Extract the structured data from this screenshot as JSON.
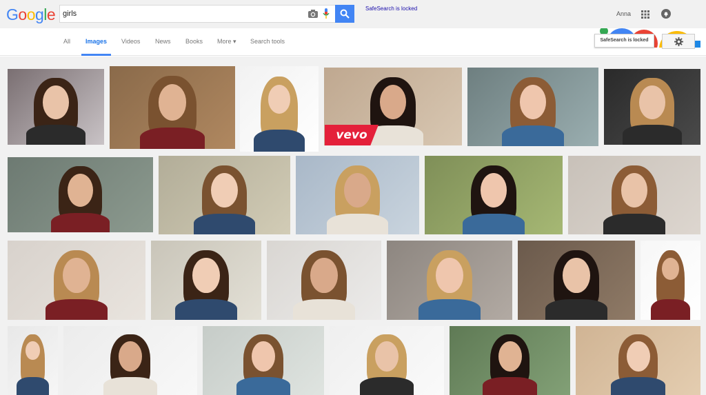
{
  "header": {
    "logo_letters": [
      {
        "ch": "G",
        "color": "#4285f4"
      },
      {
        "ch": "o",
        "color": "#ea4335"
      },
      {
        "ch": "o",
        "color": "#fbbc05"
      },
      {
        "ch": "g",
        "color": "#4285f4"
      },
      {
        "ch": "l",
        "color": "#34a853"
      },
      {
        "ch": "e",
        "color": "#ea4335"
      }
    ],
    "search_value": "girls",
    "safesearch_link": "SafeSearch is locked",
    "user_name": "Anna"
  },
  "nav": {
    "tabs": [
      {
        "id": "all",
        "label": "All"
      },
      {
        "id": "images",
        "label": "Images"
      },
      {
        "id": "videos",
        "label": "Videos"
      },
      {
        "id": "news",
        "label": "News"
      },
      {
        "id": "books",
        "label": "Books"
      },
      {
        "id": "more",
        "label": "More ▾"
      },
      {
        "id": "tools",
        "label": "Search tools"
      }
    ],
    "active_tab": "images",
    "safesearch_popup": "SafeSearch is locked"
  },
  "results": {
    "overlay_badge": "vevo",
    "thumbnail_count": 24
  },
  "colors": {
    "accent": "#4285f4",
    "vevo": "#e4203a",
    "background": "#f1f1f1"
  }
}
